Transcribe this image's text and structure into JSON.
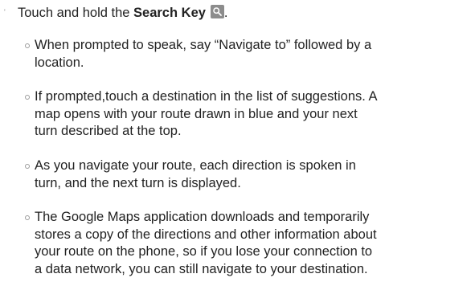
{
  "main_step": {
    "bullet": "'",
    "text_before": "Touch and hold the ",
    "key_name": "Search Key",
    "text_after": ".",
    "icon": "search-icon"
  },
  "sub_items": [
    {
      "lines": [
        "When prompted to speak, say “Navigate to” followed by a",
        "location."
      ]
    },
    {
      "lines": [
        "If prompted,touch a destination in the list of suggestions. A",
        "map opens with your route drawn in blue and your next",
        "turn described at the top."
      ]
    },
    {
      "lines": [
        "As you navigate your route, each direction is spoken in",
        "turn, and the next turn is displayed."
      ]
    },
    {
      "lines": [
        "The Google Maps application downloads and temporarily",
        "stores a copy of the directions and other information about",
        "your route on the phone, so if you lose your connection to",
        "a data network, you can still navigate to your destination."
      ]
    }
  ]
}
